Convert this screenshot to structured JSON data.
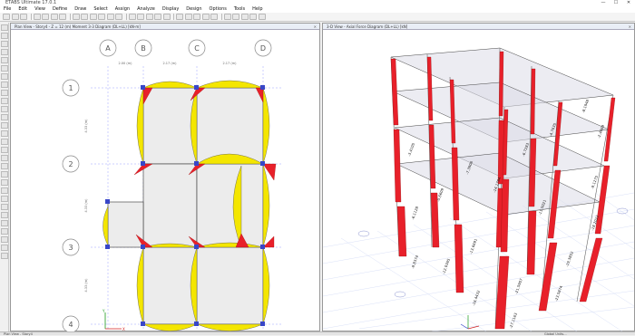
{
  "window": {
    "title": "ETABS Ultimate 17.0.1",
    "controls": [
      "—",
      "☐",
      "✕"
    ]
  },
  "menu": [
    "File",
    "Edit",
    "View",
    "Define",
    "Draw",
    "Select",
    "Assign",
    "Analyze",
    "Display",
    "Design",
    "Options",
    "Tools",
    "Help"
  ],
  "left_panel": {
    "tab_title": "Plan View - Story4 - Z = 12 (m)    Moment 3-3 Diagram   (DL+LL)  [kN-m]",
    "grid_columns": [
      "A",
      "B",
      "C",
      "D"
    ],
    "grid_rows": [
      "1",
      "2",
      "3",
      "4"
    ],
    "dims": [
      "2.00 (m)",
      "2.17 (m)",
      "2.17 (m)"
    ],
    "row_dims": [
      "4.33 (m)",
      "4.33 (m)",
      "4.33 (m)"
    ],
    "axis_labels": [
      "Y",
      "X"
    ]
  },
  "right_panel": {
    "tab_title": "3-D View  -  Axial Force Diagram   (DL+LL)  [kN]",
    "labels": [
      "-8.1948",
      "-2.4869",
      "-4.7635",
      "-6.7283",
      "-14.1784",
      "-7.3906",
      "-9.1275",
      "-18.2022",
      "-5.6609",
      "-3.4105",
      "-19.3852",
      "-11.5021",
      "-21.5907",
      "-6.1128",
      "-13.6691",
      "-23.5874",
      "-12.0365",
      "-9.8374",
      "-27.1163",
      "-16.4432"
    ]
  },
  "status": {
    "left": "Plan View - Story4",
    "right": "Global   Units..."
  },
  "colors": {
    "moment_fill": "#f4e600",
    "axial_fill": "#e8202a",
    "slab_fill": "#efefef",
    "grid_line": "#9aa0ff",
    "beam": "#3846c8"
  }
}
